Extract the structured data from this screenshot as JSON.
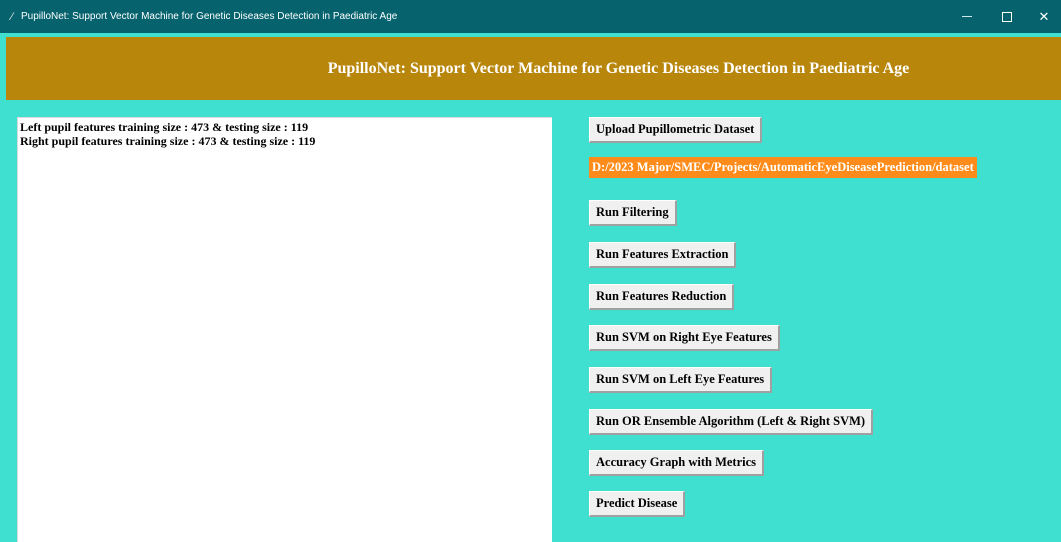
{
  "window": {
    "title": "PupilloNet: Support Vector Machine for Genetic Diseases Detection in Paediatric Age"
  },
  "banner": {
    "title": "PupilloNet: Support Vector Machine for Genetic Diseases Detection in Paediatric Age"
  },
  "output": {
    "lines": [
      "Left pupil features training size : 473 & testing size : 119",
      "Right pupil features training size : 473 & testing size : 119"
    ]
  },
  "dataset_path": "D:/2023 Major/SMEC/Projects/AutomaticEyeDiseasePrediction/dataset",
  "buttons": {
    "upload": "Upload Pupillometric Dataset",
    "filtering": "Run Filtering",
    "features_extraction": "Run Features Extraction",
    "features_reduction": "Run Features Reduction",
    "svm_right": "Run SVM on Right Eye Features",
    "svm_left": "Run SVM on Left Eye Features",
    "or_ensemble": "Run OR Ensemble Algorithm (Left & Right SVM)",
    "accuracy_graph": "Accuracy Graph with Metrics",
    "predict": "Predict Disease"
  },
  "colors": {
    "titlebar": "#06636E",
    "background": "#40E0D0",
    "banner": "#B8860B",
    "path_label": "#FF8C1A"
  },
  "icons": {
    "app": "feather-icon",
    "minimize": "minimize-icon",
    "maximize": "maximize-icon",
    "close": "close-icon"
  }
}
